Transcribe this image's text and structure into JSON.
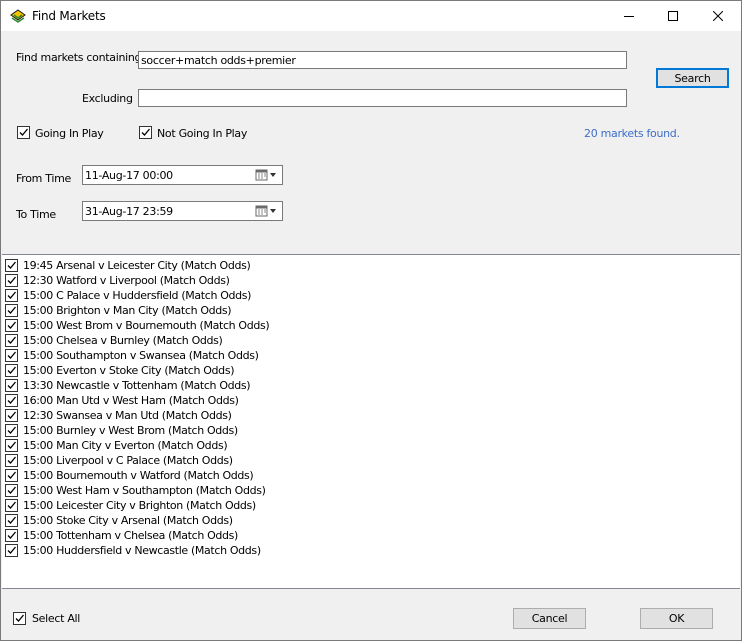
{
  "window": {
    "title": "Find Markets"
  },
  "form": {
    "containing_label": "Find markets containing",
    "containing_value": "soccer+match odds+premier",
    "excluding_label": "Excluding",
    "excluding_value": "",
    "search_label": "Search",
    "going_in_play_label": "Going In Play",
    "going_in_play_checked": true,
    "not_going_in_play_label": "Not Going In Play",
    "not_going_in_play_checked": true,
    "status": "20 markets found.",
    "from_time_label": "From Time",
    "from_time_value": "11-Aug-17 00:00",
    "to_time_label": "To Time",
    "to_time_value": "31-Aug-17 23:59"
  },
  "markets": [
    "19:45 Arsenal v Leicester City (Match Odds)",
    "12:30 Watford v Liverpool (Match Odds)",
    "15:00 C Palace v Huddersfield (Match Odds)",
    "15:00 Brighton v Man City (Match Odds)",
    "15:00 West Brom v Bournemouth (Match Odds)",
    "15:00 Chelsea v Burnley (Match Odds)",
    "15:00 Southampton v Swansea (Match Odds)",
    "15:00 Everton v Stoke City (Match Odds)",
    "13:30 Newcastle v Tottenham (Match Odds)",
    "16:00 Man Utd v West Ham (Match Odds)",
    "12:30 Swansea v Man Utd (Match Odds)",
    "15:00 Burnley v West Brom (Match Odds)",
    "15:00 Man City v Everton (Match Odds)",
    "15:00 Liverpool v C Palace (Match Odds)",
    "15:00 Bournemouth v Watford (Match Odds)",
    "15:00 West Ham v Southampton (Match Odds)",
    "15:00 Leicester City v Brighton (Match Odds)",
    "15:00 Stoke City v Arsenal (Match Odds)",
    "15:00 Tottenham v Chelsea (Match Odds)",
    "15:00 Huddersfield v Newcastle (Match Odds)"
  ],
  "footer": {
    "select_all_label": "Select All",
    "select_all_checked": true,
    "cancel_label": "Cancel",
    "ok_label": "OK"
  },
  "icons": {
    "app": "betfair-logo-icon",
    "minimize": "minimize-icon",
    "maximize": "maximize-icon",
    "close": "close-icon",
    "calendar": "calendar-dropdown-icon",
    "check": "checkmark-icon"
  },
  "colors": {
    "status_text": "#3d6ec9",
    "default_button_border": "#0078d7"
  }
}
